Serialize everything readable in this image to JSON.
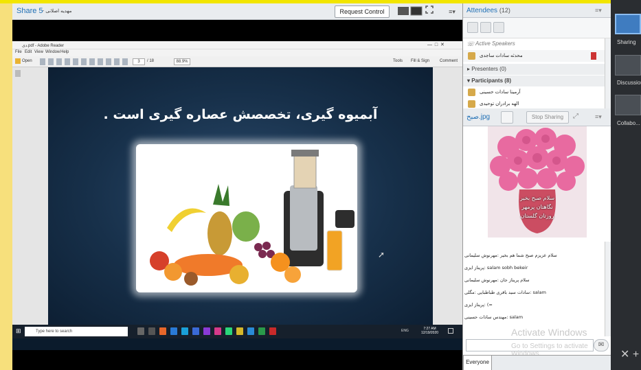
{
  "share_pod": {
    "title": "Share 5",
    "presenter": "- مهدیه اصلانی",
    "request_control": "Request Control"
  },
  "acrobat": {
    "title": "دی.pdf - Adobe Reader",
    "menu": [
      "File",
      "Edit",
      "View",
      "Window",
      "Help"
    ],
    "open": "Open",
    "page": "3",
    "page_total": "/ 18",
    "zoom": "88.9%",
    "tools": "Tools",
    "fill_sign": "Fill & Sign",
    "comment": "Comment"
  },
  "slide": {
    "title": "آبمیوه گیری، تخصصش عصاره گیری است ."
  },
  "taskbar": {
    "search_placeholder": "Type here to search",
    "lang": "ENG",
    "time": "7:27 AM",
    "date": "12/19/2020"
  },
  "attendees": {
    "title": "Attendees",
    "count": "(12)",
    "active_speakers_label": "Active Speakers",
    "active_speaker": "محدثه سادات ساجدی",
    "presenters_label": "Presenters (0)",
    "participants_label": "Participants (8)",
    "participants": [
      "آرمینا سادات حسینی",
      "الهه برادران توحیدی"
    ]
  },
  "image_pod": {
    "title": "صبح.jpg",
    "stop_sharing": "Stop Sharing",
    "caption": [
      "سلام صبح بخیر",
      "نگاهتان پرمهر",
      "روزتان گلستان"
    ]
  },
  "chat": {
    "messages": [
      "سلام عزیزم صبح شما هم بخیر :مهرنوش سلیمانی",
      "salam sobh bekeir :پریناز ایزی",
      "سلام پریناز جان :مهرنوش سلیمانی",
      "salam :سادات سید باقری طباطبایی :مگلی",
      "=) :پریناز ایزی",
      "salam :مهندس سادات حسینی"
    ],
    "watermark": "Activate Windows",
    "watermark2": "Go to Settings to activate Windows.",
    "tab": "Everyone"
  },
  "layouts": {
    "items": [
      "Sharing",
      "Discussion",
      "Collabo..."
    ]
  },
  "colors": {
    "accent": "#1f6fb5",
    "top_strip": "#f2e500",
    "left_strip": "#f7e07c"
  }
}
